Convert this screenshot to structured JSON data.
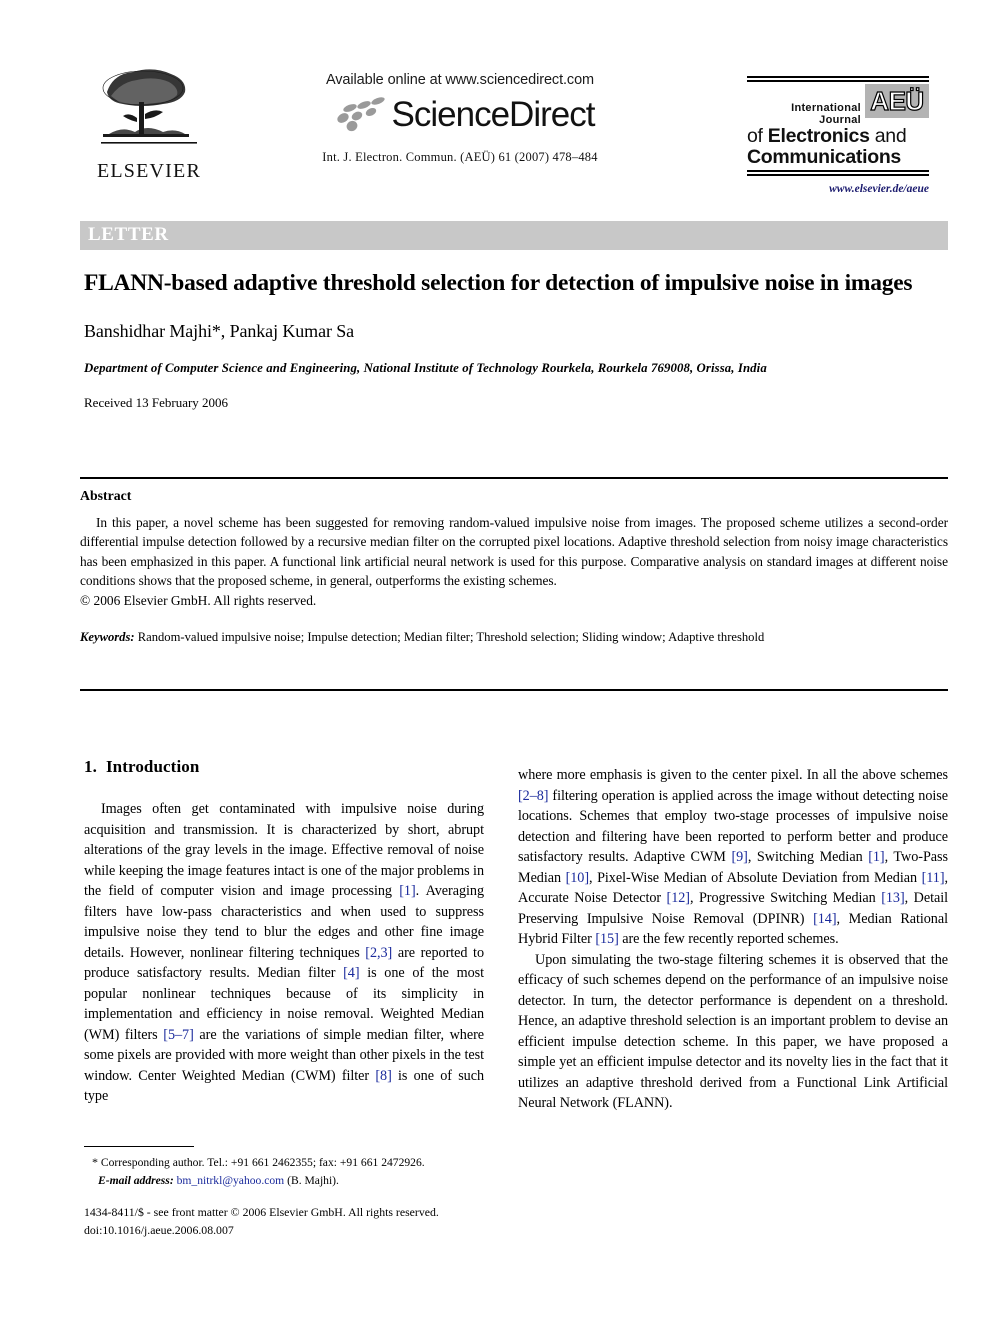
{
  "masthead": {
    "publisher_name": "ELSEVIER",
    "available_online": "Available online at www.sciencedirect.com",
    "sciencedirect_wordmark": "ScienceDirect",
    "journal_citation": "Int. J. Electron. Commun. (AEÜ) 61 (2007) 478–484",
    "aeu_tag": "AEÜ",
    "aeu_line1": "International Journal",
    "aeu_line2_thin": "of ",
    "aeu_line2_bold": "Electronics",
    "aeu_line2_tail": " and",
    "aeu_line3": "Communications",
    "aeu_url": "www.elsevier.de/aeue"
  },
  "banner": {
    "label": "LETTER",
    "background_color": "#c8c8c8",
    "text_color": "#ffffff"
  },
  "article": {
    "title": "FLANN-based adaptive threshold selection for detection of impulsive noise in images",
    "authors": "Banshidhar Majhi*, Pankaj Kumar Sa",
    "affiliation": "Department of Computer Science and Engineering, National Institute of Technology Rourkela, Rourkela 769008, Orissa, India",
    "received": "Received 13 February 2006"
  },
  "abstract": {
    "heading": "Abstract",
    "text": "In this paper, a novel scheme has been suggested for removing random-valued impulsive noise from images. The proposed scheme utilizes a second-order differential impulse detection followed by a recursive median filter on the corrupted pixel locations. Adaptive threshold selection from noisy image characteristics has been emphasized in this paper. A functional link artificial neural network is used for this purpose. Comparative analysis on standard images at different noise conditions shows that the proposed scheme, in general, outperforms the existing schemes.",
    "copyright": "© 2006 Elsevier GmbH. All rights reserved.",
    "keywords_label": "Keywords:",
    "keywords_value": " Random-valued impulsive noise; Impulse detection; Median filter; Threshold selection; Sliding window; Adaptive threshold"
  },
  "body": {
    "section_number": "1.",
    "section_title": "Introduction",
    "left_paragraph_parts": {
      "p1_a": "Images often get contaminated with impulsive noise during acquisition and transmission. It is characterized by short, abrupt alterations of the gray levels in the image. Effective removal of noise while keeping the image features intact is one of the major problems in the field of computer vision and image processing ",
      "p1_r1": "[1]",
      "p1_b": ". Averaging filters have low-pass characteristics and when used to suppress impulsive noise they tend to blur the edges and other fine image details. However, nonlinear filtering techniques ",
      "p1_r2": "[2,3]",
      "p1_c": " are reported to produce satisfactory results. Median filter ",
      "p1_r3": "[4]",
      "p1_d": " is one of the most popular nonlinear techniques because of its simplicity in implementation and efficiency in noise removal. Weighted Median (WM) filters ",
      "p1_r4": "[5–7]",
      "p1_e": " are the variations of simple median filter, where some pixels are provided with more weight than other pixels in the test window. Center Weighted Median (CWM) filter ",
      "p1_r5": "[8]",
      "p1_f": " is one of such type"
    },
    "right_paragraph_parts": {
      "p2_a": "where more emphasis is given to the center pixel. In all the above schemes ",
      "p2_r1": "[2–8]",
      "p2_b": " filtering operation is applied across the image without detecting noise locations. Schemes that employ two-stage processes of impulsive noise detection and filtering have been reported to perform better and produce satisfactory results. Adaptive CWM ",
      "p2_r2": "[9]",
      "p2_c": ", Switching Median ",
      "p2_r3": "[1]",
      "p2_d": ", Two-Pass Median ",
      "p2_r4": "[10]",
      "p2_e": ", Pixel-Wise Median of Absolute Deviation from Median ",
      "p2_r5": "[11]",
      "p2_f": ", Accurate Noise Detector ",
      "p2_r6": "[12]",
      "p2_g": ", Progressive Switching Median ",
      "p2_r7": "[13]",
      "p2_h": ", Detail Preserving Impulsive Noise Removal (DPINR) ",
      "p2_r8": "[14]",
      "p2_i": ", Median Rational Hybrid Filter ",
      "p2_r9": "[15]",
      "p2_j": " are the few recently reported schemes.",
      "p3": "Upon simulating the two-stage filtering schemes it is observed that the efficacy of such schemes depend on the performance of an impulsive noise detector. In turn, the detector performance is dependent on a threshold. Hence, an adaptive threshold selection is an important problem to devise an efficient impulse detection scheme. In this paper, we have proposed a simple yet an efficient impulse detector and its novelty lies in the fact that it utilizes an adaptive threshold derived from a Functional Link Artificial Neural Network (FLANN)."
    }
  },
  "footnote": {
    "star": "*",
    "corresponding": " Corresponding author. Tel.: +91 661 2462355; fax: +91 661 2472926.",
    "email_label": "E-mail address:",
    "email": "bm_nitrkl@yahoo.com",
    "email_suffix": " (B. Majhi)."
  },
  "footer": {
    "issn_line": "1434-8411/$ - see front matter © 2006 Elsevier GmbH. All rights reserved.",
    "doi_line": "doi:10.1016/j.aeue.2006.08.007"
  }
}
